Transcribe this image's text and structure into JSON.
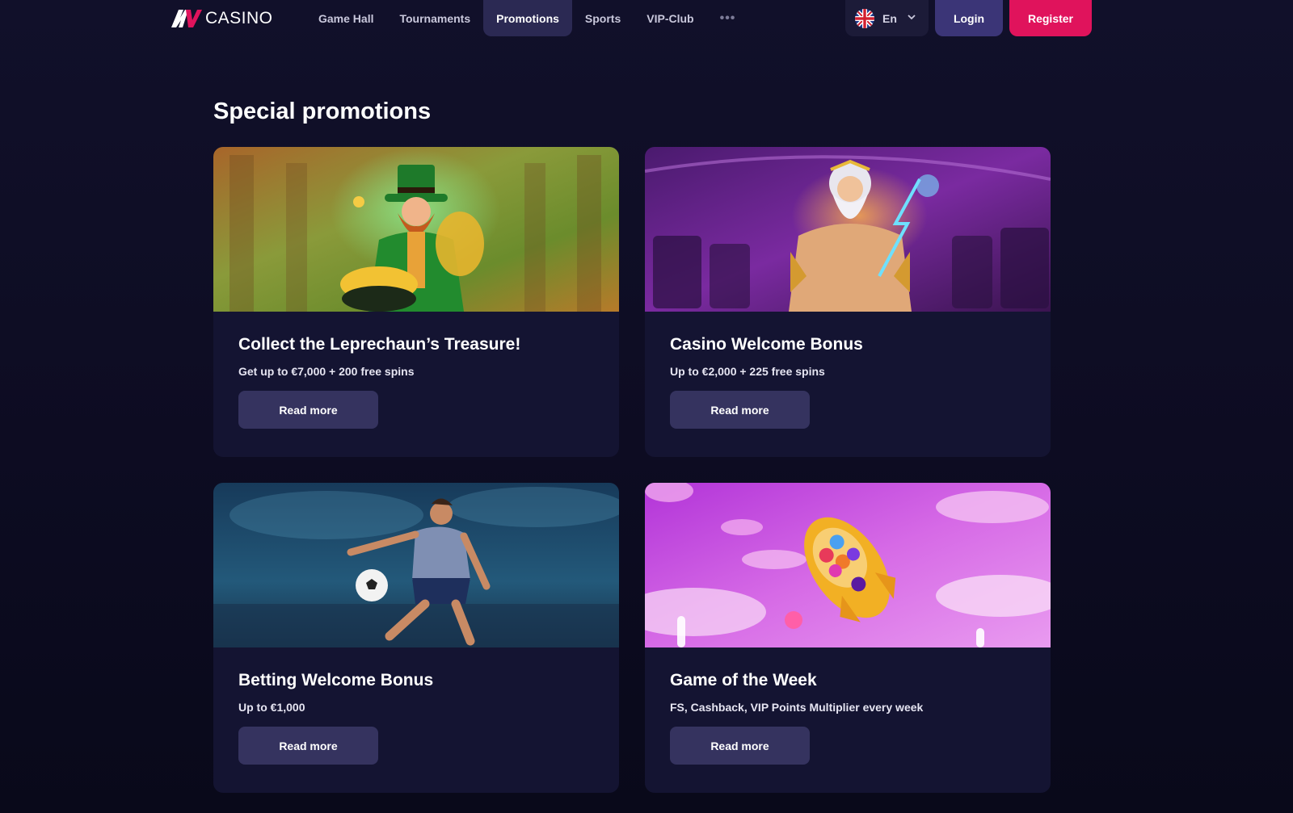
{
  "brand": {
    "logo_text": "CASINO"
  },
  "nav": {
    "items": [
      {
        "label": "Game Hall"
      },
      {
        "label": "Tournaments"
      },
      {
        "label": "Promotions",
        "active": true
      },
      {
        "label": "Sports"
      },
      {
        "label": "VIP-Club"
      }
    ],
    "more_label": "•••"
  },
  "language": {
    "label": "En",
    "flag_icon": "uk-flag-icon"
  },
  "auth": {
    "login_label": "Login",
    "register_label": "Register"
  },
  "colors": {
    "accent": "#e0135c",
    "login": "#3b3577",
    "active_nav": "#2b2953",
    "card_bg": "#141432",
    "button_bg": "#35335f"
  },
  "page": {
    "title": "Special promotions"
  },
  "promotions": [
    {
      "title": "Collect the Leprechaun’s Treasure!",
      "subtitle": "Get up to €7,000 + 200 free spins",
      "button": "Read more",
      "image": "leprechaun-image"
    },
    {
      "title": "Casino Welcome Bonus",
      "subtitle": "Up to €2,000 + 225 free spins",
      "button": "Read more",
      "image": "zeus-image"
    },
    {
      "title": "Betting Welcome Bonus",
      "subtitle": "Up to €1,000",
      "button": "Read more",
      "image": "football-player-image"
    },
    {
      "title": "Game of the Week",
      "subtitle": "FS, Cashback, VIP Points Multiplier every week",
      "button": "Read more",
      "image": "candy-rocket-image"
    }
  ]
}
